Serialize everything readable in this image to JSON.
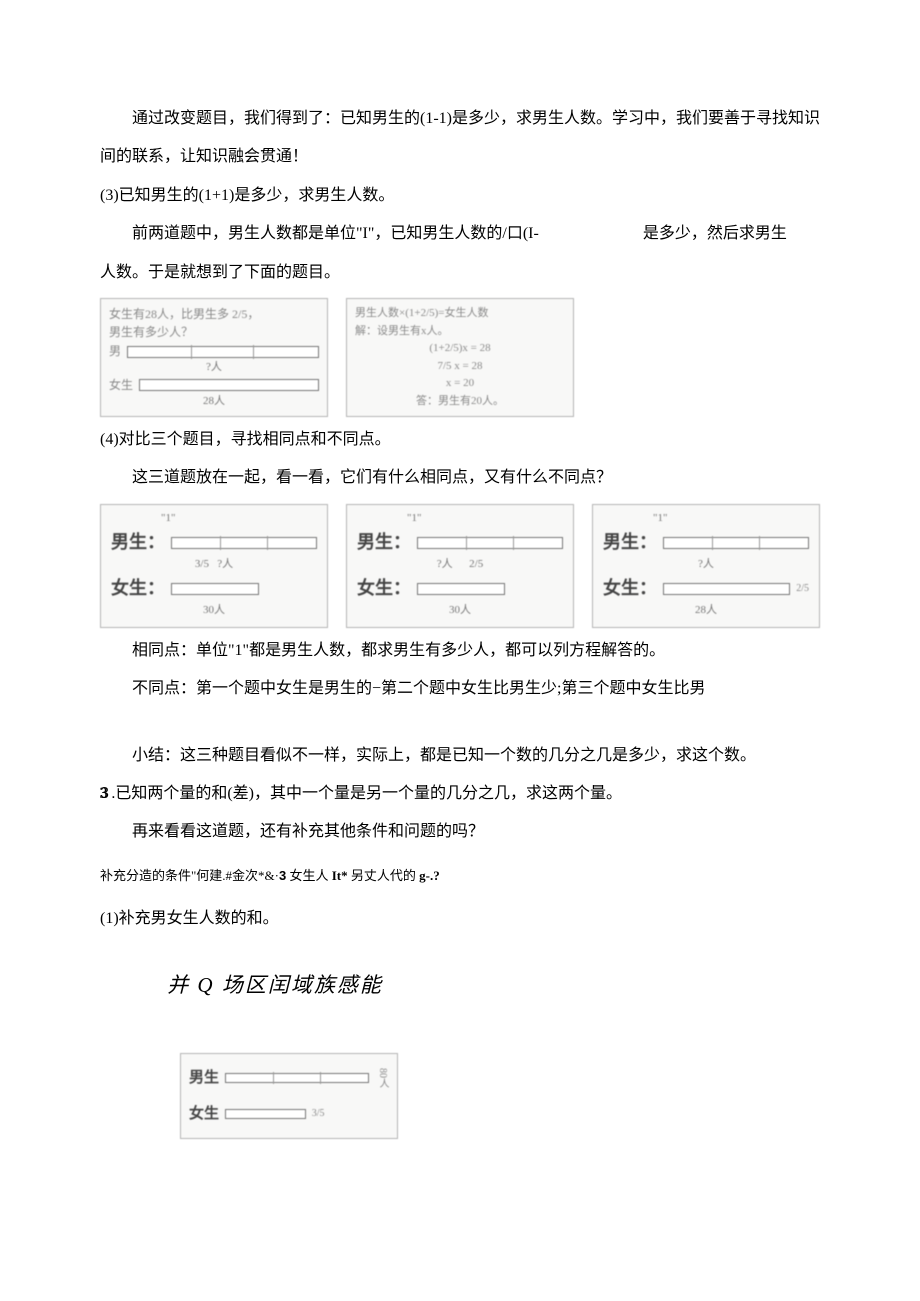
{
  "p1": "通过改变题目，我们得到了：已知男生的(1-1)是多少，求男生人数。学习中，我们要善于寻找知识间的联系，让知识融会贯通！",
  "p2": "(3)已知男生的(1+1)是多少，求男生人数。",
  "p3_a": "前两道题中，男生人数都是单位\"I\"，已知男生人数的/口(I-",
  "p3_b": "是多少，然后求男生",
  "p3_c": "人数。于是就想到了下面的题目。",
  "box1": {
    "l1": "女生有28人，比男生多 2/5，",
    "l2": "男生有多少人？",
    "l3": "男",
    "l4": "?人",
    "l5": "女生",
    "l6": "28人"
  },
  "box2": {
    "l1": "男生人数×(1+2/5)=女生人数",
    "l2": "解：设男生有x人。",
    "l3": "(1+2/5)x = 28",
    "l4": "7/5 x = 28",
    "l5": "x = 20",
    "l6": "答：男生有20人。"
  },
  "p4": "(4)对比三个题目，寻找相同点和不同点。",
  "p5": "这三道题放在一起，看一看，它们有什么相同点，又有什么不同点？",
  "diag": {
    "male": "男生：",
    "female": "女生：",
    "q": "?人",
    "n30": "30人",
    "n28": "28人",
    "one": "\"1\"",
    "frac35": "3/5",
    "frac25": "2/5"
  },
  "p6": "相同点：单位\"1\"都是男生人数，都求男生有多少人，都可以列方程解答的。",
  "p7": "不同点：第一个题中女生是男生的−第二个题中女生比男生少;第三个题中女生比男",
  "p8": "小结：这三种题目看似不一样，实际上，都是已知一个数的几分之几是多少，求这个数。",
  "p9": "3 .已知两个量的和(差)，其中一个量是另一个量的几分之几，求这两个量。",
  "p10": "再来看看这道题，还有补充其他条件和问题的吗？",
  "p11": "补充分造的条件\"何建.#金次*&·3 女生人 It* 另丈人代的 g-.?",
  "p12": "(1)补充男女生人数的和。",
  "p13": "并 Q 场区闰域族感能",
  "box3": {
    "male": "男生",
    "female": "女生",
    "frac": "3/5",
    "total": "80人"
  }
}
